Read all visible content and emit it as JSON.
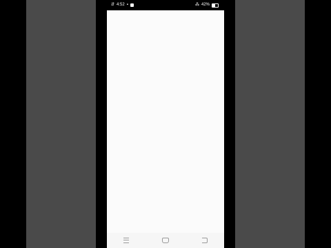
{
  "status_bar": {
    "time": "4:52",
    "battery": "42%",
    "icons": [
      "notification-icon",
      "facebook-icon",
      "signal-icon",
      "battery-icon"
    ]
  },
  "nav_bar": {
    "buttons": [
      "menu",
      "home",
      "back"
    ]
  },
  "colors": {
    "outer_background": "#000000",
    "side_panel": "#4a4a4a",
    "screen_background": "#fbfbfb"
  }
}
